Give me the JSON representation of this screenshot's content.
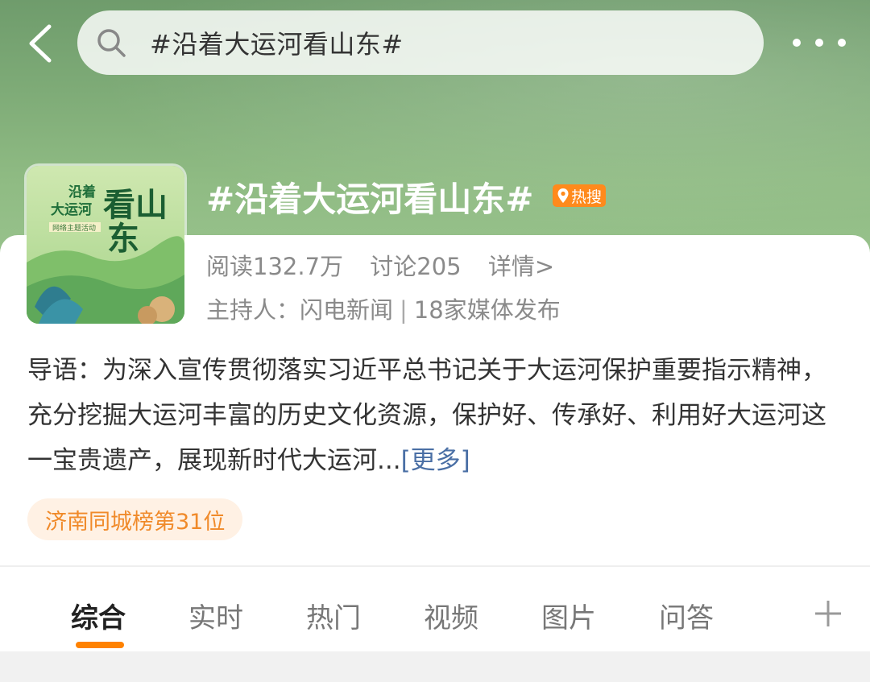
{
  "search": {
    "query": "#沿着大运河看山东#"
  },
  "topic": {
    "title": "#沿着大运河看山东#",
    "hot_badge": "热搜",
    "cover": {
      "line1": "沿着",
      "line2": "大运河",
      "big1": "看山",
      "big2": "东",
      "subtitle": "网络主题活动"
    },
    "stats": {
      "reads": "阅读132.7万",
      "discussions": "讨论205",
      "details": "详情>"
    },
    "host_label": "主持人：闪电新闻",
    "separator": "|",
    "media": "18家媒体发布",
    "intro": "导语：为深入宣传贯彻落实习近平总书记关于大运河保护重要指示精神，充分挖掘大运河丰富的历史文化资源，保护好、传承好、利用好大运河这一宝贵遗产，展现新时代大运河...",
    "intro_more": "[更多]",
    "rank_badge": "济南同城榜第31位"
  },
  "tabs": [
    {
      "label": "综合",
      "active": true
    },
    {
      "label": "实时",
      "active": false
    },
    {
      "label": "热门",
      "active": false
    },
    {
      "label": "视频",
      "active": false
    },
    {
      "label": "图片",
      "active": false
    },
    {
      "label": "问答",
      "active": false
    }
  ],
  "colors": {
    "accent": "#ff8200",
    "link": "#4a6fa5",
    "hero_green": "#7eab77"
  }
}
